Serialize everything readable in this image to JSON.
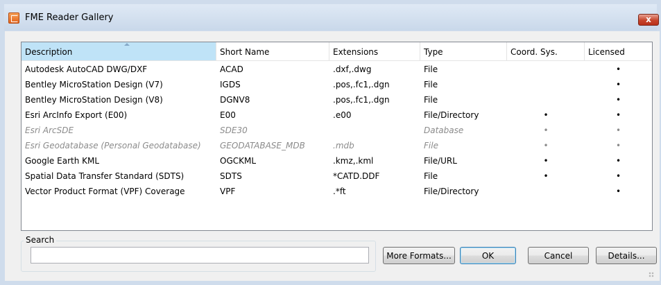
{
  "window": {
    "title": "FME Reader Gallery",
    "close_label": "x"
  },
  "table": {
    "columns": [
      "Description",
      "Short Name",
      "Extensions",
      "Type",
      "Coord. Sys.",
      "Licensed"
    ],
    "sorted_column": "Description",
    "rows": [
      {
        "description": "Autodesk AutoCAD DWG/DXF",
        "short_name": "ACAD",
        "extensions": ".dxf,.dwg",
        "type": "File",
        "coord_sys": "",
        "licensed": "•",
        "enabled": true
      },
      {
        "description": "Bentley MicroStation Design (V7)",
        "short_name": "IGDS",
        "extensions": ".pos,.fc1,.dgn",
        "type": "File",
        "coord_sys": "",
        "licensed": "•",
        "enabled": true
      },
      {
        "description": "Bentley MicroStation Design (V8)",
        "short_name": "DGNV8",
        "extensions": ".pos,.fc1,.dgn",
        "type": "File",
        "coord_sys": "",
        "licensed": "•",
        "enabled": true
      },
      {
        "description": "Esri ArcInfo Export (E00)",
        "short_name": "E00",
        "extensions": ".e00",
        "type": "File/Directory",
        "coord_sys": "•",
        "licensed": "•",
        "enabled": true
      },
      {
        "description": "Esri ArcSDE",
        "short_name": "SDE30",
        "extensions": "",
        "type": "Database",
        "coord_sys": "•",
        "licensed": "•",
        "enabled": false
      },
      {
        "description": "Esri Geodatabase (Personal Geodatabase)",
        "short_name": "GEODATABASE_MDB",
        "extensions": ".mdb",
        "type": "File",
        "coord_sys": "•",
        "licensed": "•",
        "enabled": false
      },
      {
        "description": "Google Earth KML",
        "short_name": "OGCKML",
        "extensions": ".kmz,.kml",
        "type": "File/URL",
        "coord_sys": "•",
        "licensed": "•",
        "enabled": true
      },
      {
        "description": "Spatial Data Transfer Standard (SDTS)",
        "short_name": "SDTS",
        "extensions": "*CATD.DDF",
        "type": "File",
        "coord_sys": "•",
        "licensed": "•",
        "enabled": true
      },
      {
        "description": "Vector Product Format (VPF) Coverage",
        "short_name": "VPF",
        "extensions": ".*ft",
        "type": "File/Directory",
        "coord_sys": "",
        "licensed": "•",
        "enabled": true
      }
    ]
  },
  "search": {
    "label": "Search",
    "value": "",
    "placeholder": ""
  },
  "buttons": {
    "more_formats": "More Formats...",
    "ok": "OK",
    "cancel": "Cancel",
    "details": "Details..."
  },
  "colors": {
    "sorted_header": "#bfe3f7",
    "disabled_text": "#8b8b8b",
    "close_button": "#c6452c"
  }
}
